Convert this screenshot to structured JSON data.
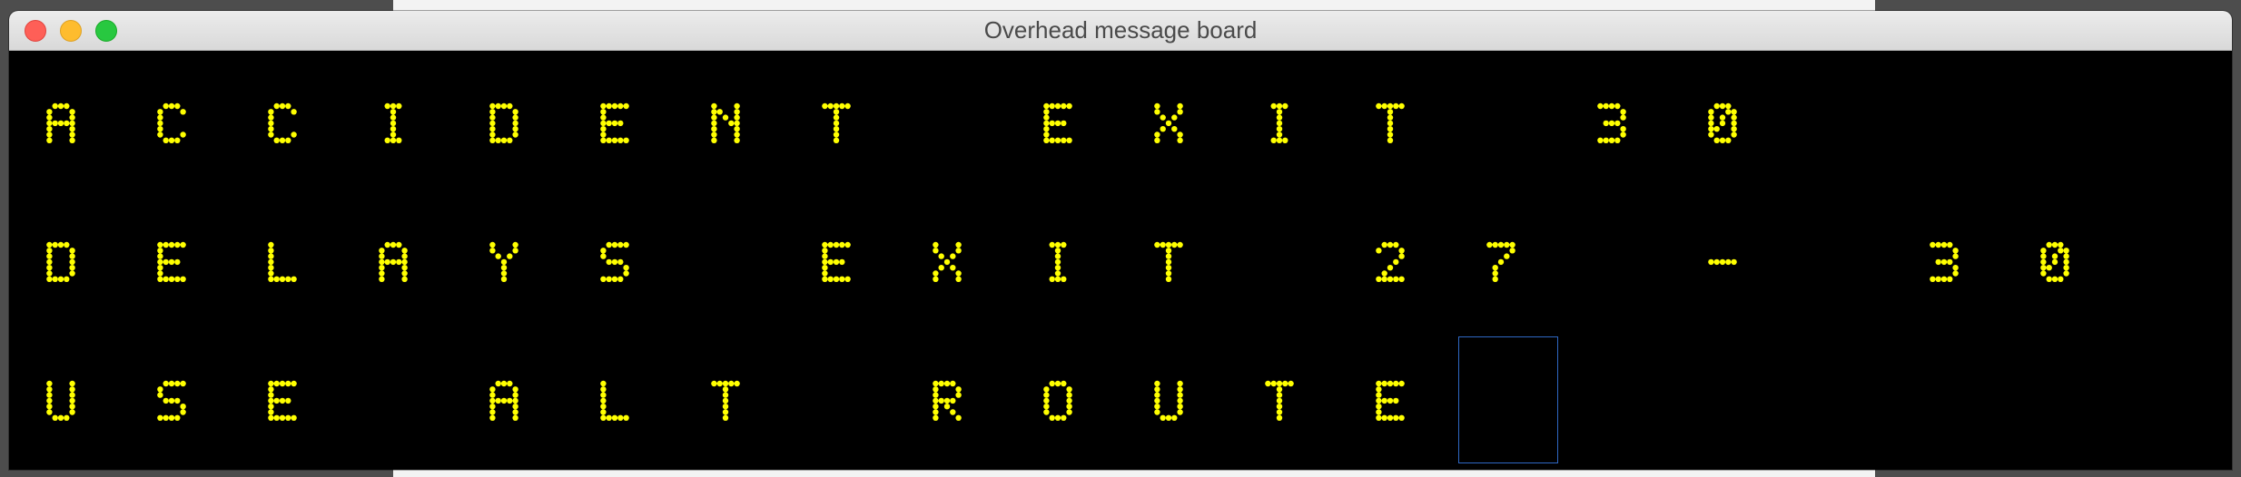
{
  "window": {
    "title": "Overhead message board"
  },
  "board": {
    "led_color": "#ffff00",
    "background_color": "#000000",
    "cursor_color": "#2f68c4",
    "columns": 19,
    "rows": [
      "ACCIDENT EXIT 30",
      "DELAYS EXIT 27 - 30",
      "USE ALT ROUTE"
    ]
  },
  "colors": {
    "close": "#fe5f57",
    "minimize": "#febc2e",
    "maximize": "#28c840"
  }
}
